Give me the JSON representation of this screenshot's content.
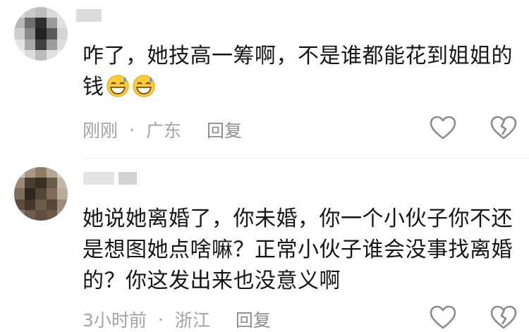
{
  "comments": [
    {
      "text": "咋了，她技高一筹啊，不是谁都能花到姐姐的钱",
      "time": "刚刚",
      "separator": "·",
      "location": "广东",
      "reply_label": "回复",
      "emoji": [
        "grinning-sweat-emoji",
        "grinning-sweat-emoji"
      ]
    },
    {
      "text": "她说她离婚了，你未婚，你一个小伙子你不还是想图她点啥嘛？正常小伙子谁会没事找离婚的？你这发出来也没意义啊",
      "time": "3小时前",
      "separator": "·",
      "location": "浙江",
      "reply_label": "回复"
    }
  ],
  "icons": {
    "like": "heart-outline-icon",
    "dislike": "broken-heart-icon"
  },
  "colors": {
    "text": "#161616",
    "meta": "#a3a3a3",
    "icon": "#8c8c8c",
    "emoji_face": "#ffcc33"
  }
}
